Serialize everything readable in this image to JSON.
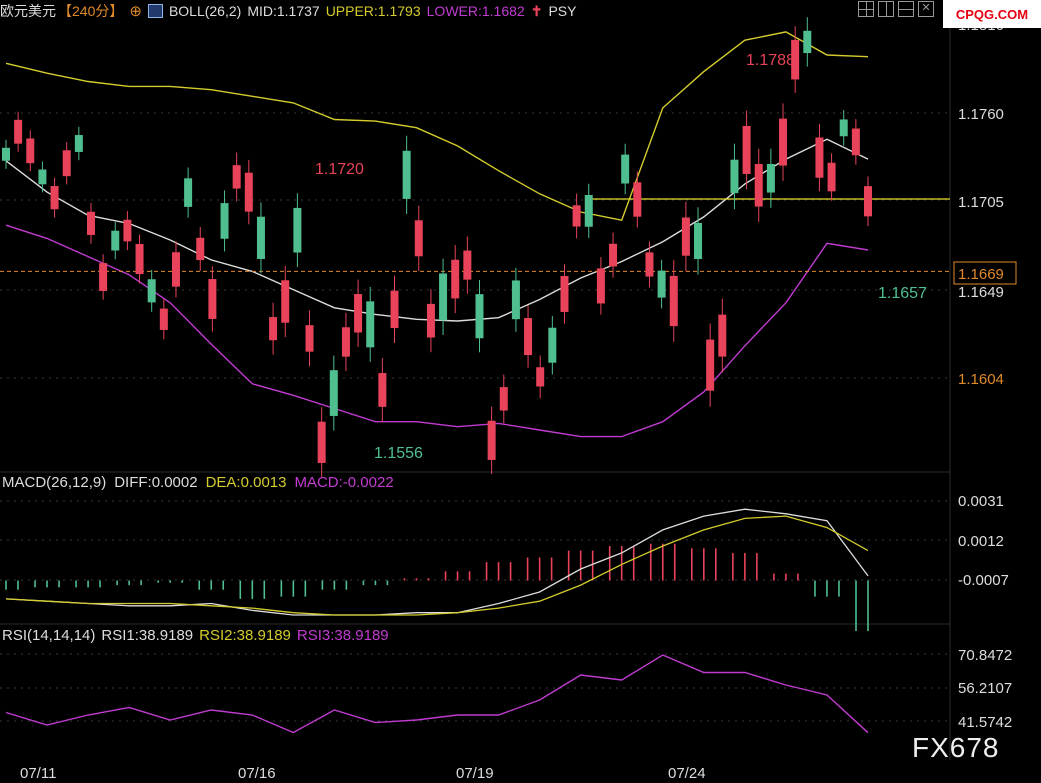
{
  "header": {
    "symbol": "欧元美元",
    "period": "【240分】",
    "indicator": "BOLL(26,2)",
    "mid": "MID:1.1737",
    "upper": "UPPER:1.1793",
    "lower": "LOWER:1.1682",
    "psy": "PSY"
  },
  "logo_text": "CPQG.COM",
  "watermark": "FX678",
  "main_axis": {
    "ticks": [
      "1.1760",
      "1.1705",
      "1.1649",
      "1.1604"
    ],
    "current_price": "1.1669",
    "top_partial": "1.1816"
  },
  "annotations": {
    "high_label": "1.1788",
    "local_high_label": "1.1720",
    "low_label": "1.1556",
    "last_low_label": "1.1657"
  },
  "macd": {
    "title": "MACD(26,12,9)",
    "diff": "DIFF:0.0002",
    "dea": "DEA:0.0013",
    "macd": "MACD:-0.0022",
    "ticks": [
      "0.0031",
      "0.0012",
      "-0.0007"
    ]
  },
  "rsi": {
    "title": "RSI(14,14,14)",
    "rsi1": "RSI1:38.9189",
    "rsi2": "RSI2:38.9189",
    "rsi3": "RSI3:38.9189",
    "ticks": [
      "70.8472",
      "56.2107",
      "41.5742"
    ]
  },
  "x_labels": [
    "07/11",
    "07/16",
    "07/19",
    "07/24"
  ],
  "colors": {
    "up": "#e8435a",
    "down": "#4fbf8f",
    "upper": "#d4cc2e",
    "mid": "#dddddd",
    "lower": "#c13bd1",
    "price_line": "#e08a2a",
    "ref_line": "#e8e02e",
    "rsi": "#c13bd1"
  },
  "chart_data": [
    {
      "type": "candlestick",
      "title": "欧元美元 240分 BOLL(26,2)",
      "ylim": [
        1.155,
        1.182
      ],
      "series": [
        {
          "name": "UPPER",
          "values": [
            1.1795,
            1.1789,
            1.1784,
            1.1781,
            1.1781,
            1.1779,
            1.1775,
            1.1771,
            1.1761,
            1.176,
            1.1756,
            1.1745,
            1.173,
            1.1716,
            1.1705,
            1.17,
            1.1768,
            1.179,
            1.1809,
            1.1814,
            1.18,
            1.1799
          ]
        },
        {
          "name": "MID",
          "values": [
            1.1736,
            1.1717,
            1.1703,
            1.1698,
            1.1688,
            1.1676,
            1.1669,
            1.1658,
            1.1647,
            1.1643,
            1.164,
            1.1639,
            1.1641,
            1.1652,
            1.1665,
            1.1675,
            1.1687,
            1.1702,
            1.1722,
            1.1737,
            1.1749,
            1.1737
          ]
        },
        {
          "name": "LOWER",
          "values": [
            1.1697,
            1.1689,
            1.1678,
            1.1667,
            1.165,
            1.1625,
            1.1601,
            1.1594,
            1.1586,
            1.1578,
            1.1578,
            1.1575,
            1.1577,
            1.1573,
            1.1569,
            1.1569,
            1.1578,
            1.1596,
            1.1624,
            1.165,
            1.1686,
            1.1682
          ]
        }
      ],
      "annotations": {
        "high": 1.1788,
        "local_high": 1.172,
        "low": 1.1556,
        "last_low": 1.1657,
        "current": 1.1669
      }
    },
    {
      "type": "bar",
      "title": "MACD(26,12,9)",
      "ylim": [
        -0.0015,
        0.0035
      ],
      "series": [
        {
          "name": "DIFF",
          "values": [
            -0.0008,
            -0.0009,
            -0.001,
            -0.0011,
            -0.0011,
            -0.001,
            -0.0013,
            -0.0015,
            -0.0015,
            -0.0015,
            -0.0014,
            -0.0014,
            -0.001,
            -0.0005,
            0.0005,
            0.0012,
            0.0022,
            0.0028,
            0.0031,
            0.0029,
            0.0026,
            0.0002
          ]
        },
        {
          "name": "DEA",
          "values": [
            -0.0008,
            -0.0009,
            -0.001,
            -0.001,
            -0.001,
            -0.0011,
            -0.0012,
            -0.0014,
            -0.0015,
            -0.0015,
            -0.0015,
            -0.0014,
            -0.0012,
            -0.0009,
            -0.0002,
            0.0007,
            0.0015,
            0.0022,
            0.0027,
            0.0028,
            0.0023,
            0.0013
          ]
        },
        {
          "name": "MACD",
          "values": [
            -0.0004,
            -0.0003,
            -0.0003,
            -0.0002,
            -0.0001,
            -0.0004,
            -0.0008,
            -0.0007,
            -0.0004,
            -0.0002,
            0.0001,
            0.0004,
            0.0008,
            0.001,
            0.0013,
            0.0015,
            0.0016,
            0.0014,
            0.0012,
            0.0003,
            -0.0007,
            -0.0022
          ]
        }
      ]
    },
    {
      "type": "line",
      "title": "RSI(14,14,14)",
      "ylim": [
        38,
        72
      ],
      "series": [
        {
          "name": "RSI1",
          "values": [
            47,
            42,
            46,
            49,
            44,
            48,
            46,
            39,
            48,
            43,
            44,
            46,
            46,
            52,
            62,
            60,
            70,
            63,
            63,
            58,
            54,
            38.9189
          ]
        }
      ]
    }
  ]
}
